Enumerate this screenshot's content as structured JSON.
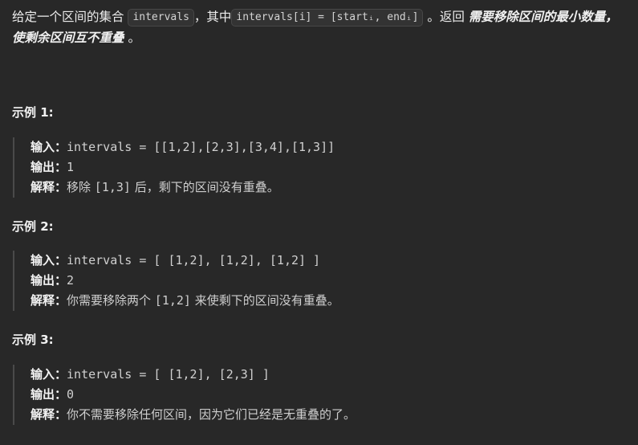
{
  "intro": {
    "p1": "给定一个区间的集合",
    "code1": "intervals",
    "p2": "，其中",
    "code2": "intervals[i] = [startᵢ, endᵢ]",
    "p3": "。返回",
    "emph": "需要移除区间的最小数量，使剩余区间互不重叠",
    "p4": "。"
  },
  "labels": {
    "input": "输入：",
    "output": "输出：",
    "explanation": "解释："
  },
  "examples": [
    {
      "title": "示例 1:",
      "input": "intervals = [[1,2],[2,3],[3,4],[1,3]]",
      "output": "1",
      "expl_a": "移除 ",
      "expl_code": "[1,3]",
      "expl_b": " 后，剩下的区间没有重叠。"
    },
    {
      "title": "示例 2:",
      "input": "intervals = [ [1,2], [1,2], [1,2] ]",
      "output": "2",
      "expl_a": "你需要移除两个 ",
      "expl_code": "[1,2]",
      "expl_b": " 来使剩下的区间没有重叠。"
    },
    {
      "title": "示例 3:",
      "input": "intervals = [ [1,2], [2,3] ]",
      "output": "0",
      "expl_a": "你不需要移除任何区间，因为它们已经是无重叠的了。",
      "expl_code": "",
      "expl_b": ""
    }
  ]
}
